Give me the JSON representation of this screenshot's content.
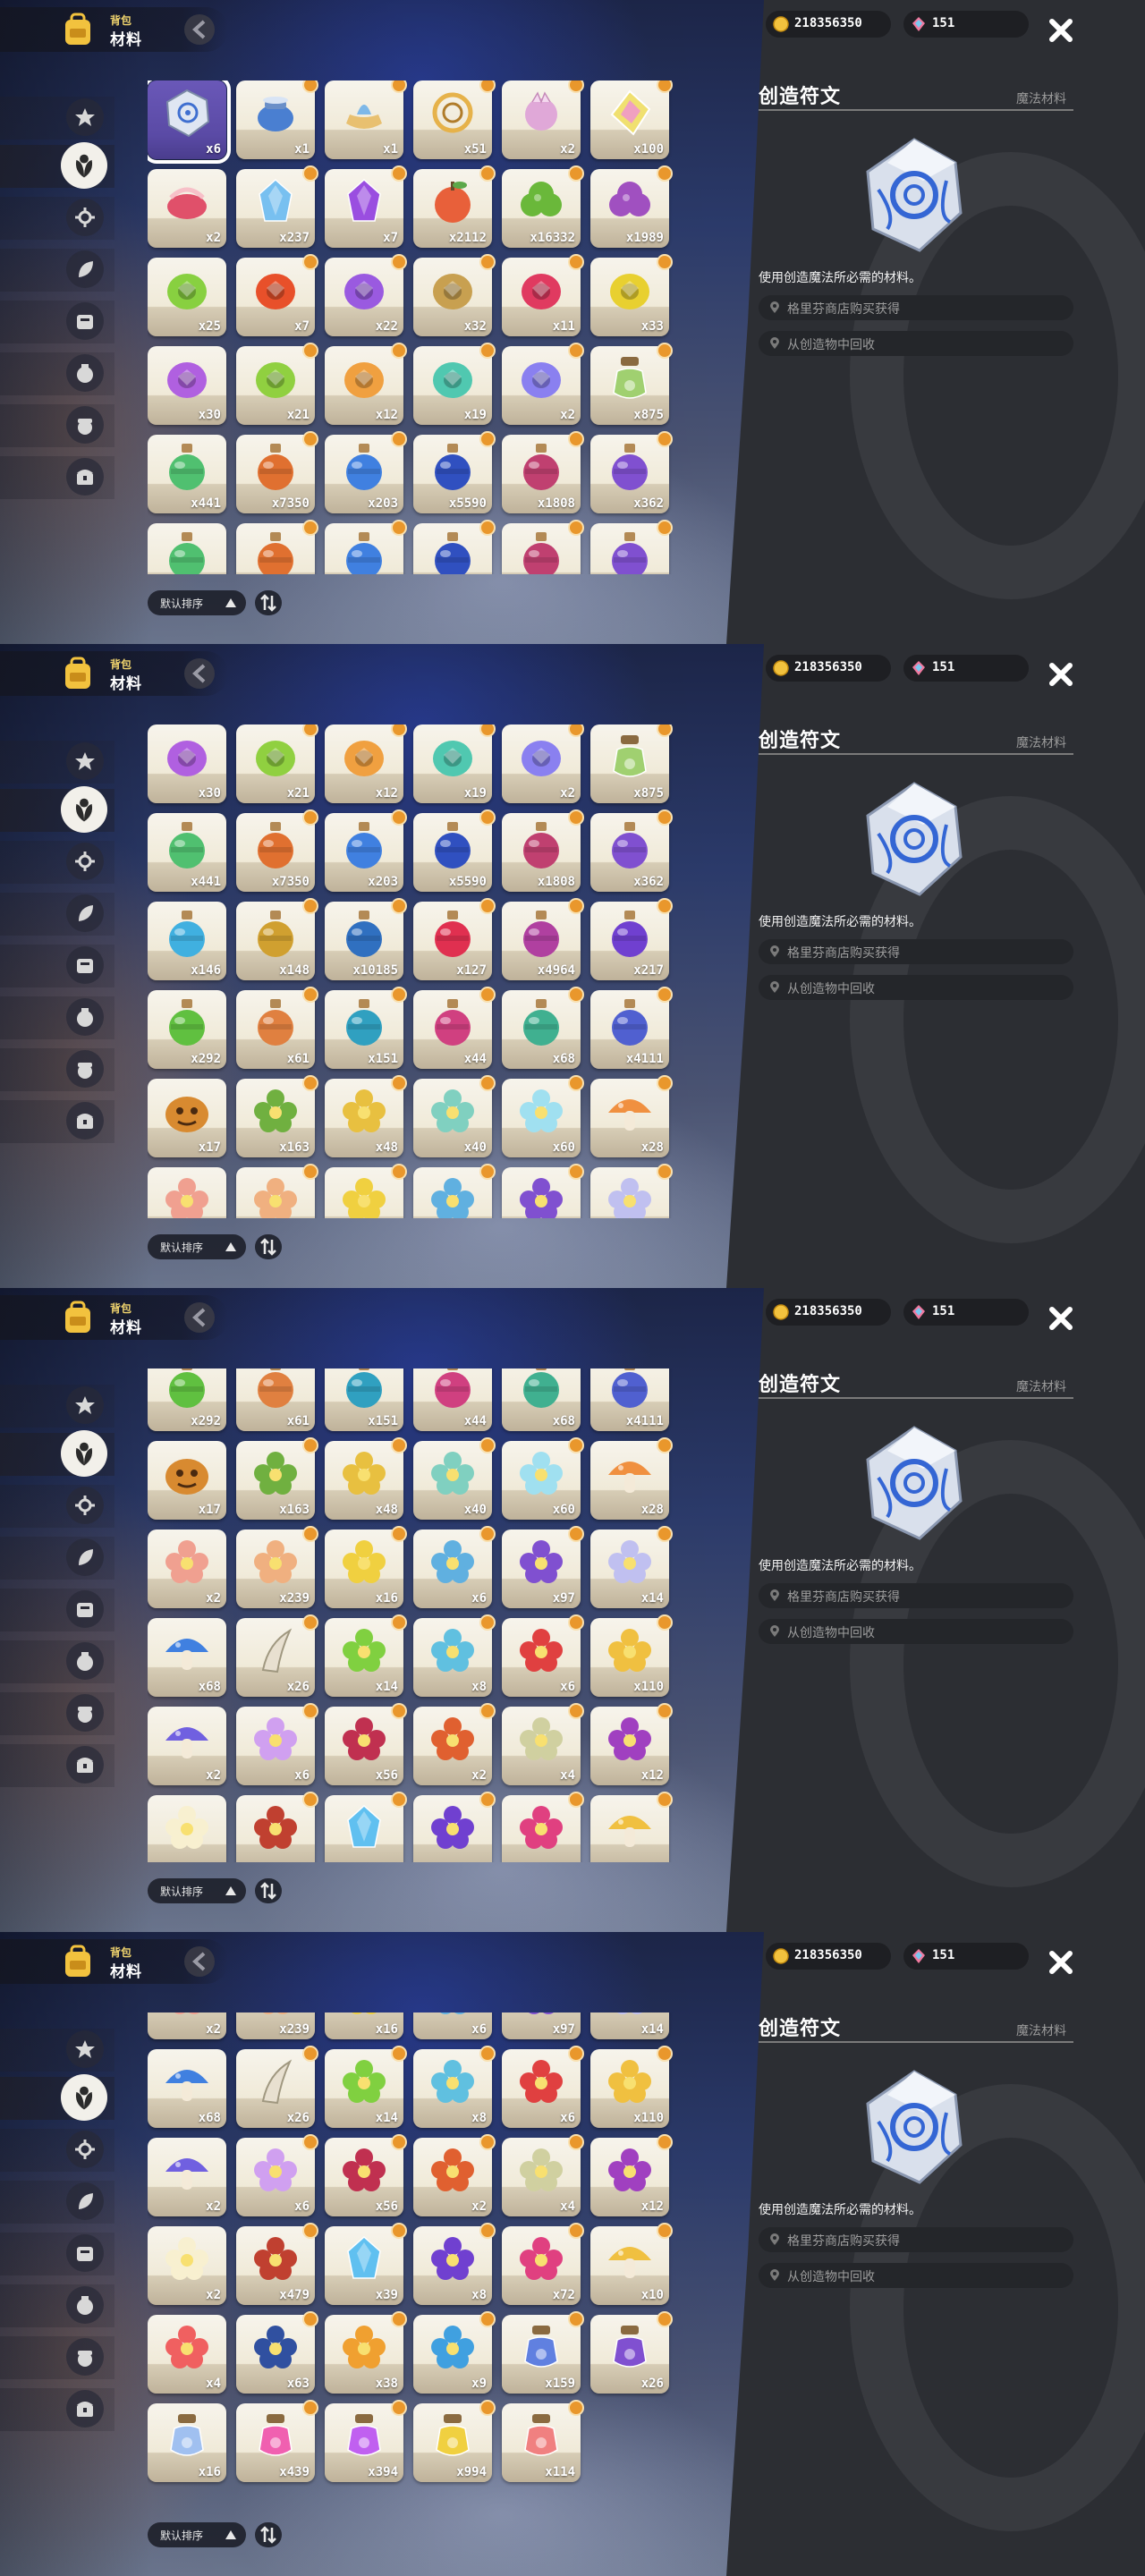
{
  "header": {
    "subtitle": "背包",
    "title": "材料"
  },
  "currency": {
    "gold": "218356350",
    "gems": "151"
  },
  "detail": {
    "name": "创造符文",
    "type": "魔法材料",
    "description": "使用创造魔法所必需的材料。",
    "sources": [
      "格里芬商店购买获得",
      "从创造物中回收"
    ]
  },
  "sort": {
    "label": "默认排序"
  },
  "sidebar": {
    "tabs": [
      "star-tab-icon",
      "leaf-tab-icon",
      "gear-tab-icon",
      "plant-tab-icon",
      "box-tab-icon",
      "pot-tab-icon",
      "acorn-tab-icon",
      "chest-tab-icon"
    ],
    "active_index": 1
  },
  "screens": [
    {
      "rows": [
        [
          {
            "c": "x6",
            "k": "rune",
            "col": "#c8d2e8",
            "sel": true
          },
          {
            "c": "x1",
            "k": "pot",
            "col": "#4a7fd1"
          },
          {
            "c": "x1",
            "k": "lamp",
            "col": "#7eb8e8"
          },
          {
            "c": "x51",
            "k": "gold",
            "col": "#e6b24a"
          },
          {
            "c": "x2",
            "k": "pink",
            "col": "#e0a8d8"
          },
          {
            "c": "x100",
            "k": "gem",
            "col": "#f0e070"
          }
        ],
        [
          {
            "c": "x2",
            "k": "ribbon",
            "col": "#e0506a"
          },
          {
            "c": "x237",
            "k": "crystal",
            "col": "#78c0f0"
          },
          {
            "c": "x7",
            "k": "crystal",
            "col": "#9a4ee0"
          },
          {
            "c": "x2112",
            "k": "apple",
            "col": "#e8603a"
          },
          {
            "c": "x16332",
            "k": "bush",
            "col": "#6ab83a"
          },
          {
            "c": "x1989",
            "k": "bush",
            "col": "#a050c0"
          }
        ],
        [
          {
            "c": "x25",
            "k": "ring",
            "col": "#88d040"
          },
          {
            "c": "x7",
            "k": "ring",
            "col": "#e8502a"
          },
          {
            "c": "x22",
            "k": "ring",
            "col": "#9a5ae0"
          },
          {
            "c": "x32",
            "k": "ring",
            "col": "#c8a050"
          },
          {
            "c": "x11",
            "k": "ring",
            "col": "#e03a60"
          },
          {
            "c": "x33",
            "k": "ring",
            "col": "#e8d030"
          }
        ],
        [
          {
            "c": "x30",
            "k": "ring",
            "col": "#b060e0"
          },
          {
            "c": "x21",
            "k": "ring",
            "col": "#90d040"
          },
          {
            "c": "x12",
            "k": "ring",
            "col": "#f0a040"
          },
          {
            "c": "x19",
            "k": "ring",
            "col": "#50c8b0"
          },
          {
            "c": "x2",
            "k": "ring",
            "col": "#8a80f0"
          },
          {
            "c": "x875",
            "k": "bottle",
            "col": "#a0d070"
          }
        ],
        [
          {
            "c": "x441",
            "k": "potion",
            "col": "#50c070"
          },
          {
            "c": "x7350",
            "k": "potion",
            "col": "#e07030"
          },
          {
            "c": "x203",
            "k": "potion",
            "col": "#4080e0"
          },
          {
            "c": "x5590",
            "k": "potion",
            "col": "#3050c0"
          },
          {
            "c": "x1808",
            "k": "potion",
            "col": "#c04070"
          },
          {
            "c": "x362",
            "k": "potion",
            "col": "#8050d0"
          }
        ],
        [
          {
            "c": "",
            "k": "potion",
            "col": "#50c070"
          },
          {
            "c": "",
            "k": "potion",
            "col": "#e07030"
          },
          {
            "c": "",
            "k": "potion",
            "col": "#4080e0"
          },
          {
            "c": "",
            "k": "potion",
            "col": "#3050c0"
          },
          {
            "c": "",
            "k": "potion",
            "col": "#c04070"
          },
          {
            "c": "",
            "k": "potion",
            "col": "#8050d0"
          }
        ]
      ]
    },
    {
      "rows": [
        [
          {
            "c": "x30",
            "k": "ring",
            "col": "#b060e0"
          },
          {
            "c": "x21",
            "k": "ring",
            "col": "#90d040"
          },
          {
            "c": "x12",
            "k": "ring",
            "col": "#f0a040"
          },
          {
            "c": "x19",
            "k": "ring",
            "col": "#50c8b0"
          },
          {
            "c": "x2",
            "k": "ring",
            "col": "#8a80f0"
          },
          {
            "c": "x875",
            "k": "bottle",
            "col": "#a0d070"
          }
        ],
        [
          {
            "c": "x441",
            "k": "potion",
            "col": "#50c070"
          },
          {
            "c": "x7350",
            "k": "potion",
            "col": "#e07030"
          },
          {
            "c": "x203",
            "k": "potion",
            "col": "#4080e0"
          },
          {
            "c": "x5590",
            "k": "potion",
            "col": "#3050c0"
          },
          {
            "c": "x1808",
            "k": "potion",
            "col": "#c04070"
          },
          {
            "c": "x362",
            "k": "potion",
            "col": "#8050d0"
          }
        ],
        [
          {
            "c": "x146",
            "k": "potion",
            "col": "#40b0e0"
          },
          {
            "c": "x148",
            "k": "potion",
            "col": "#d0a030"
          },
          {
            "c": "x10185",
            "k": "potion",
            "col": "#3070c0"
          },
          {
            "c": "x127",
            "k": "potion",
            "col": "#e03050"
          },
          {
            "c": "x4964",
            "k": "potion",
            "col": "#b040a0"
          },
          {
            "c": "x217",
            "k": "potion",
            "col": "#7040d0"
          }
        ],
        [
          {
            "c": "x292",
            "k": "potion",
            "col": "#60c040"
          },
          {
            "c": "x61",
            "k": "potion",
            "col": "#e08040"
          },
          {
            "c": "x151",
            "k": "potion",
            "col": "#30a0c0"
          },
          {
            "c": "x44",
            "k": "potion",
            "col": "#d04080"
          },
          {
            "c": "x68",
            "k": "potion",
            "col": "#40b090"
          },
          {
            "c": "x4111",
            "k": "potion",
            "col": "#5060d0"
          }
        ],
        [
          {
            "c": "x17",
            "k": "pumpkin",
            "col": "#d88a30"
          },
          {
            "c": "x163",
            "k": "flower",
            "col": "#70b040"
          },
          {
            "c": "x48",
            "k": "flower",
            "col": "#e8c040"
          },
          {
            "c": "x40",
            "k": "flower",
            "col": "#80d0c0"
          },
          {
            "c": "x60",
            "k": "flower",
            "col": "#a0e0f0"
          },
          {
            "c": "x28",
            "k": "mushroom",
            "col": "#f09040"
          }
        ],
        [
          {
            "c": "",
            "k": "flower",
            "col": "#f0a090"
          },
          {
            "c": "",
            "k": "flower",
            "col": "#f0b080"
          },
          {
            "c": "",
            "k": "flower",
            "col": "#f0d040"
          },
          {
            "c": "",
            "k": "flower",
            "col": "#60b0e0"
          },
          {
            "c": "",
            "k": "flower",
            "col": "#8050d0"
          },
          {
            "c": "",
            "k": "flower",
            "col": "#c0c0f0"
          }
        ]
      ]
    },
    {
      "rows": [
        [
          {
            "c": "x292",
            "k": "potion",
            "col": "#60c040"
          },
          {
            "c": "x61",
            "k": "potion",
            "col": "#e08040"
          },
          {
            "c": "x151",
            "k": "potion",
            "col": "#30a0c0"
          },
          {
            "c": "x44",
            "k": "potion",
            "col": "#d04080"
          },
          {
            "c": "x68",
            "k": "potion",
            "col": "#40b090"
          },
          {
            "c": "x4111",
            "k": "potion",
            "col": "#5060d0"
          }
        ],
        [
          {
            "c": "x17",
            "k": "pumpkin",
            "col": "#d88a30"
          },
          {
            "c": "x163",
            "k": "flower",
            "col": "#70b040"
          },
          {
            "c": "x48",
            "k": "flower",
            "col": "#e8c040"
          },
          {
            "c": "x40",
            "k": "flower",
            "col": "#80d0c0"
          },
          {
            "c": "x60",
            "k": "flower",
            "col": "#a0e0f0"
          },
          {
            "c": "x28",
            "k": "mushroom",
            "col": "#f09040"
          }
        ],
        [
          {
            "c": "x2",
            "k": "flower",
            "col": "#f0a090"
          },
          {
            "c": "x239",
            "k": "flower",
            "col": "#f0b080"
          },
          {
            "c": "x16",
            "k": "flower",
            "col": "#f0d040"
          },
          {
            "c": "x6",
            "k": "flower",
            "col": "#60b0e0"
          },
          {
            "c": "x97",
            "k": "flower",
            "col": "#8050d0"
          },
          {
            "c": "x14",
            "k": "flower",
            "col": "#c0c0f0"
          }
        ],
        [
          {
            "c": "x68",
            "k": "mushroom",
            "col": "#4080e0"
          },
          {
            "c": "x26",
            "k": "horn",
            "col": "#e8e0d0"
          },
          {
            "c": "x14",
            "k": "flower",
            "col": "#80d040"
          },
          {
            "c": "x8",
            "k": "flower",
            "col": "#60c0e0"
          },
          {
            "c": "x6",
            "k": "flower",
            "col": "#e04040"
          },
          {
            "c": "x110",
            "k": "flower",
            "col": "#f0c040"
          }
        ],
        [
          {
            "c": "x2",
            "k": "mushroom",
            "col": "#7060e0"
          },
          {
            "c": "x6",
            "k": "flower",
            "col": "#d0a0f0"
          },
          {
            "c": "x56",
            "k": "flower",
            "col": "#c03050"
          },
          {
            "c": "x2",
            "k": "flower",
            "col": "#e06030"
          },
          {
            "c": "x4",
            "k": "flower",
            "col": "#d0d0a0"
          },
          {
            "c": "x12",
            "k": "flower",
            "col": "#a040c0"
          }
        ],
        [
          {
            "c": "",
            "k": "flower",
            "col": "#f8f0d0"
          },
          {
            "c": "",
            "k": "flower",
            "col": "#c04030"
          },
          {
            "c": "",
            "k": "crystal",
            "col": "#60c0f0"
          },
          {
            "c": "",
            "k": "flower",
            "col": "#7040d0"
          },
          {
            "c": "",
            "k": "flower",
            "col": "#e04080"
          },
          {
            "c": "",
            "k": "mushroom",
            "col": "#f0c040"
          }
        ]
      ]
    },
    {
      "rows": [
        [
          {
            "c": "x2",
            "k": "flower",
            "col": "#f0a090"
          },
          {
            "c": "x239",
            "k": "flower",
            "col": "#f0b080"
          },
          {
            "c": "x16",
            "k": "flower",
            "col": "#f0d040"
          },
          {
            "c": "x6",
            "k": "flower",
            "col": "#60b0e0"
          },
          {
            "c": "x97",
            "k": "flower",
            "col": "#8050d0"
          },
          {
            "c": "x14",
            "k": "flower",
            "col": "#c0c0f0"
          }
        ],
        [
          {
            "c": "x68",
            "k": "mushroom",
            "col": "#4080e0"
          },
          {
            "c": "x26",
            "k": "horn",
            "col": "#e8e0d0"
          },
          {
            "c": "x14",
            "k": "flower",
            "col": "#80d040"
          },
          {
            "c": "x8",
            "k": "flower",
            "col": "#60c0e0"
          },
          {
            "c": "x6",
            "k": "flower",
            "col": "#e04040"
          },
          {
            "c": "x110",
            "k": "flower",
            "col": "#f0c040"
          }
        ],
        [
          {
            "c": "x2",
            "k": "mushroom",
            "col": "#7060e0"
          },
          {
            "c": "x6",
            "k": "flower",
            "col": "#d0a0f0"
          },
          {
            "c": "x56",
            "k": "flower",
            "col": "#c03050"
          },
          {
            "c": "x2",
            "k": "flower",
            "col": "#e06030"
          },
          {
            "c": "x4",
            "k": "flower",
            "col": "#d0d0a0"
          },
          {
            "c": "x12",
            "k": "flower",
            "col": "#a040c0"
          }
        ],
        [
          {
            "c": "x2",
            "k": "flower",
            "col": "#f8f0d0"
          },
          {
            "c": "x479",
            "k": "flower",
            "col": "#c04030"
          },
          {
            "c": "x39",
            "k": "crystal",
            "col": "#60c0f0"
          },
          {
            "c": "x8",
            "k": "flower",
            "col": "#7040d0"
          },
          {
            "c": "x72",
            "k": "flower",
            "col": "#e04080"
          },
          {
            "c": "x10",
            "k": "mushroom",
            "col": "#f0c040"
          }
        ],
        [
          {
            "c": "x4",
            "k": "flower",
            "col": "#f06060"
          },
          {
            "c": "x63",
            "k": "flower",
            "col": "#3050a0"
          },
          {
            "c": "x38",
            "k": "flower",
            "col": "#f0a030"
          },
          {
            "c": "x9",
            "k": "flower",
            "col": "#40a0e0"
          },
          {
            "c": "x159",
            "k": "bottle",
            "col": "#6080e0"
          },
          {
            "c": "x26",
            "k": "bottle",
            "col": "#8050d0"
          }
        ],
        [
          {
            "c": "x16",
            "k": "bottle",
            "col": "#a0c0f0"
          },
          {
            "c": "x439",
            "k": "bottle",
            "col": "#f060b0"
          },
          {
            "c": "x394",
            "k": "bottle",
            "col": "#c060f0"
          },
          {
            "c": "x994",
            "k": "bottle",
            "col": "#f0d040"
          },
          {
            "c": "x114",
            "k": "bottle",
            "col": "#f08080"
          }
        ]
      ]
    }
  ]
}
